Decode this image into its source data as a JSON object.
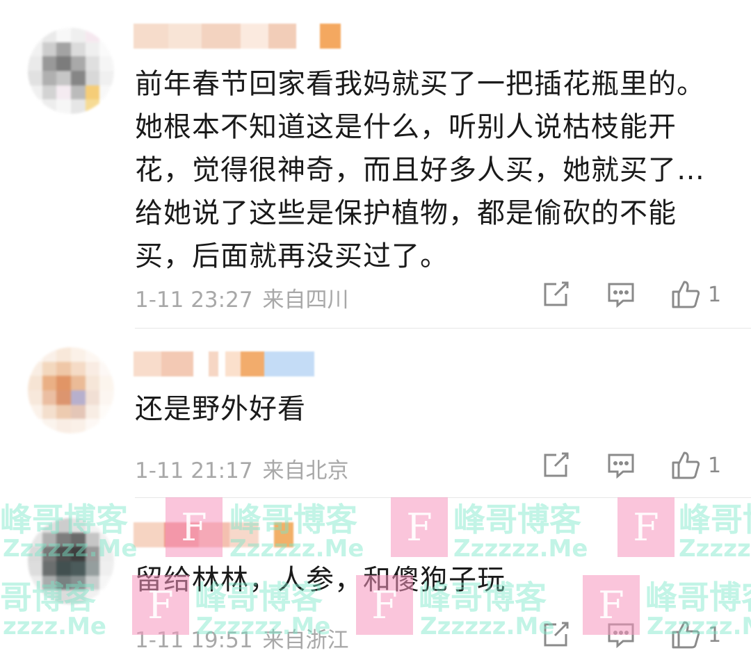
{
  "comments": [
    {
      "content": "前年春节回家看我妈就买了一把插花瓶里的。她根本不知道这是什么，听别人说枯枝能开花，觉得很神奇，而且好多人买，她就买了…给她说了这些是保护植物，都是偷砍的不能买，后面就再没买过了。",
      "lines": [
        "前年春节回家看我妈就买了一把插花瓶里的。",
        "她根本不知道这是什么，听别人说枯枝能开",
        "花，觉得很神奇，而且好多人买，她就买了…",
        "给她说了这些是保护植物，都是偷砍的不能",
        "买，后面就再没买过了。"
      ],
      "date": "1-11 23:27",
      "location": "来自四川",
      "likes": "1"
    },
    {
      "content": "还是野外好看",
      "lines": [
        "还是野外好看"
      ],
      "date": "1-11 21:17",
      "location": "来自北京",
      "likes": "1"
    },
    {
      "content": "留给林林，人参，和傻狍子玩",
      "lines": [
        "留给林林，人参，和傻狍子玩"
      ],
      "date": "1-11 19:51",
      "location": "来自浙江",
      "likes": "1"
    }
  ],
  "icons": {
    "share": "share-icon",
    "reply": "comment-icon",
    "like": "thumbs-up-icon"
  },
  "watermark": {
    "text": "峰哥博客",
    "url": "Zzzzzz.Me",
    "url_short": "zzzz.Me",
    "logo_letter": "F"
  },
  "colors": {
    "text": "#1a1a1a",
    "meta": "#a8a8a8",
    "icon": "#8a8a8a",
    "divider": "#e6e6e6",
    "watermark_text": "#78e6c8",
    "watermark_box": "#f596be"
  }
}
